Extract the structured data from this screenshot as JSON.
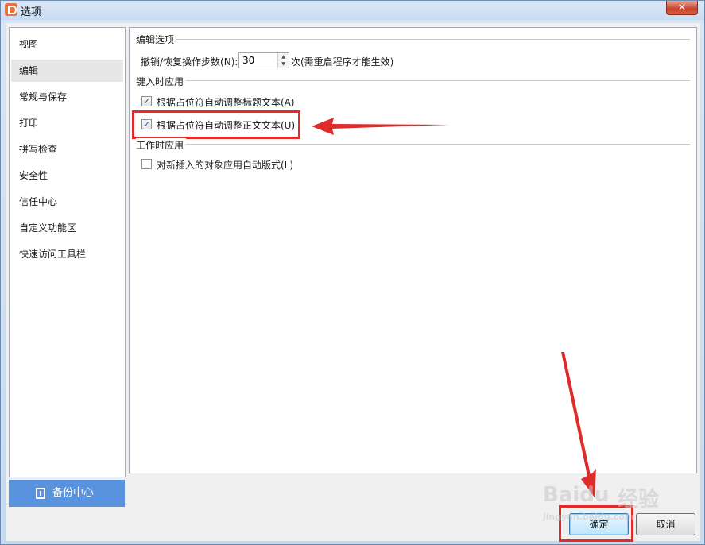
{
  "window": {
    "title": "选项",
    "close_symbol": "✕"
  },
  "sidebar": {
    "items": [
      {
        "label": "视图",
        "selected": false
      },
      {
        "label": "编辑",
        "selected": true
      },
      {
        "label": "常规与保存",
        "selected": false
      },
      {
        "label": "打印",
        "selected": false
      },
      {
        "label": "拼写检查",
        "selected": false
      },
      {
        "label": "安全性",
        "selected": false
      },
      {
        "label": "信任中心",
        "selected": false
      },
      {
        "label": "自定义功能区",
        "selected": false
      },
      {
        "label": "快速访问工具栏",
        "selected": false
      }
    ],
    "backup_label": "备份中心"
  },
  "edit_options": {
    "group_title": "编辑选项",
    "undo_label": "撤销/恢复操作步数(N):",
    "undo_value": "30",
    "undo_note": "次(需重启程序才能生效)"
  },
  "typing_group": {
    "group_title": "键入时应用",
    "options": [
      {
        "label": "根据占位符自动调整标题文本(A)",
        "checked": true
      },
      {
        "label": "根据占位符自动调整正文文本(U)",
        "checked": true
      }
    ]
  },
  "working_group": {
    "group_title": "工作时应用",
    "options": [
      {
        "label": "对新插入的对象应用自动版式(L)",
        "checked": false
      }
    ]
  },
  "buttons": {
    "ok_label": "确定",
    "cancel_label": "取消"
  },
  "watermark": {
    "brand": "Baidu",
    "brand_cn": "经验",
    "url": "jingyan.baidu.com"
  },
  "colors": {
    "annotation_red": "#e02b2b",
    "backup_blue": "#5a93dd",
    "close_red": "#c7432c"
  }
}
